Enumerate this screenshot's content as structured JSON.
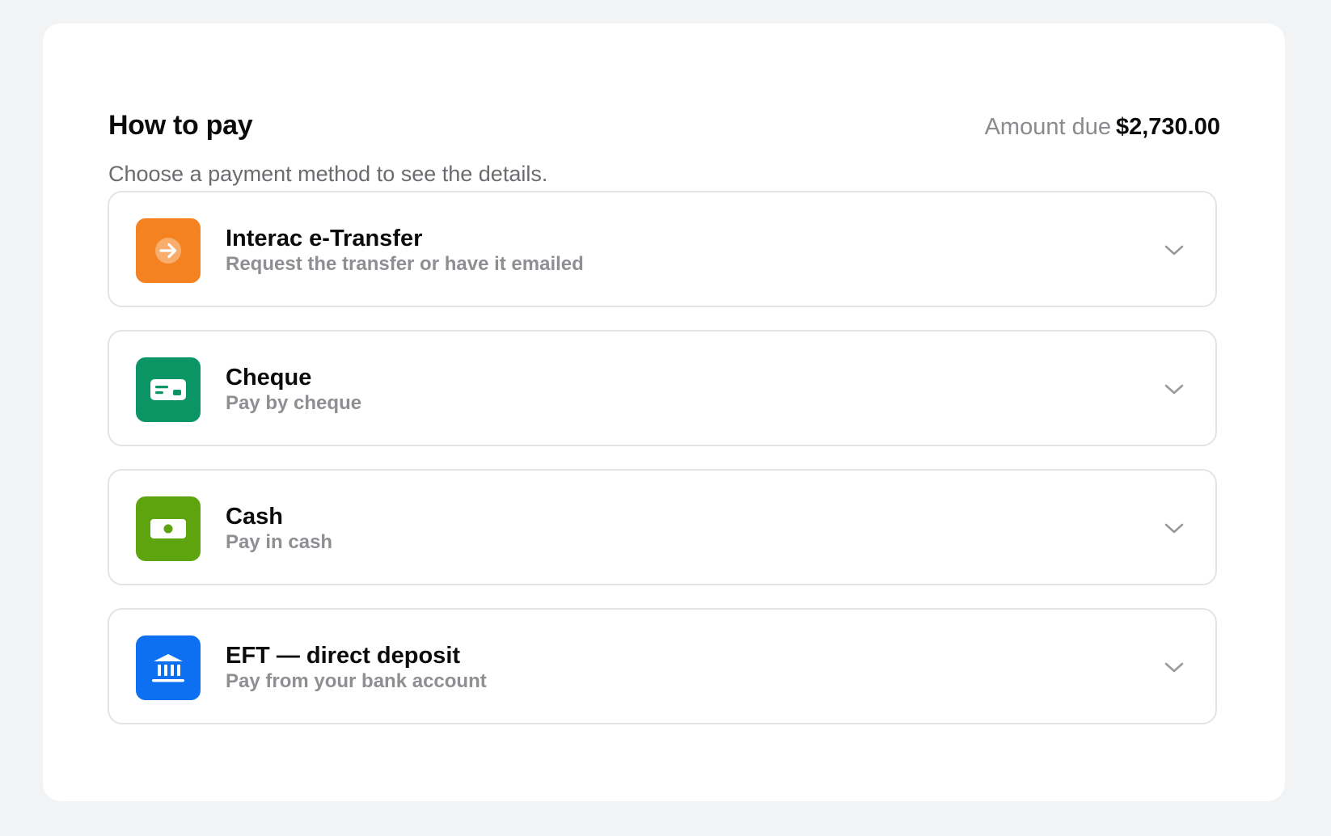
{
  "header": {
    "title": "How to pay",
    "amount_label": "Amount due",
    "amount_value": "$2,730.00",
    "subtitle": "Choose a payment method to see the details."
  },
  "methods": [
    {
      "label": "Interac e-Transfer",
      "description": "Request the transfer or have it emailed",
      "icon": "arrow-right-circle-icon",
      "color": "#f58220"
    },
    {
      "label": "Cheque",
      "description": "Pay by cheque",
      "icon": "cheque-icon",
      "color": "#0b9565"
    },
    {
      "label": "Cash",
      "description": "Pay in cash",
      "icon": "banknote-icon",
      "color": "#5ea40f"
    },
    {
      "label": "EFT — direct deposit",
      "description": "Pay from your bank account",
      "icon": "bank-icon",
      "color": "#0d6ff2"
    }
  ],
  "colors": {
    "background": "#f2f3f5",
    "card": "#ffffff",
    "border": "#e3e4e8",
    "chevron": "#9a9aa0"
  }
}
